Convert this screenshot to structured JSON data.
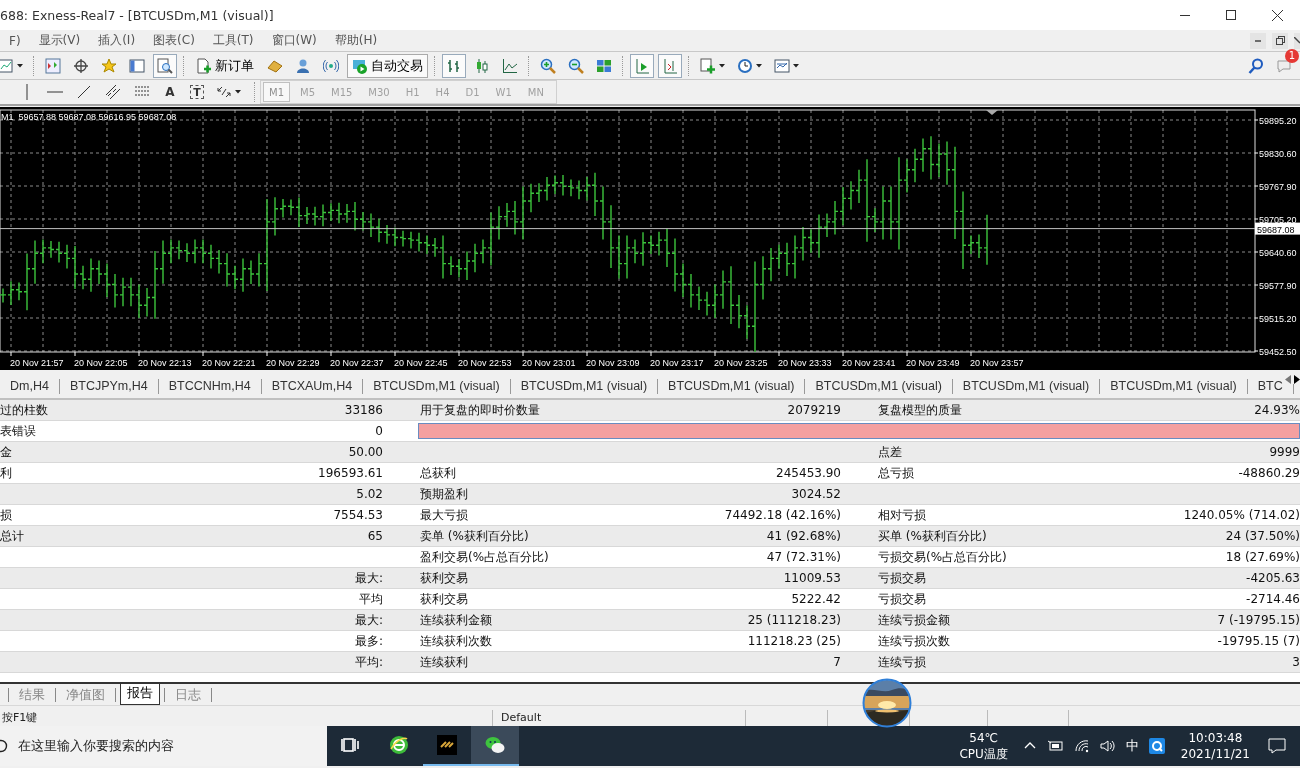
{
  "window": {
    "title": "688: Exness-Real7 - [BTCUSDm,M1 (visual)]"
  },
  "menu": [
    "F)",
    "显示(V)",
    "插入(I)",
    "图表(C)",
    "工具(T)",
    "窗口(W)",
    "帮助(H)"
  ],
  "toolbar": [
    {
      "kind": "icon",
      "pressed": false
    },
    {
      "kind": "icon",
      "pressed": false
    },
    {
      "kind": "icon",
      "pressed": false
    },
    {
      "kind": "icon",
      "pressed": false
    },
    {
      "kind": "icon",
      "pressed": false
    },
    {
      "kind": "icon",
      "pressed": true
    },
    {
      "kind": "button",
      "label": "新订单"
    },
    {
      "kind": "icon",
      "pressed": false
    },
    {
      "kind": "icon",
      "pressed": false
    },
    {
      "kind": "icon",
      "pressed": false
    },
    {
      "kind": "button",
      "label": "自动交易"
    },
    {
      "kind": "icon",
      "pressed": true
    },
    {
      "kind": "icon",
      "pressed": false
    },
    {
      "kind": "icon",
      "pressed": false
    },
    {
      "kind": "icon",
      "pressed": false
    },
    {
      "kind": "icon",
      "pressed": false
    },
    {
      "kind": "icon",
      "pressed": false
    },
    {
      "kind": "icon",
      "pressed": true
    },
    {
      "kind": "icon",
      "pressed": true
    },
    {
      "kind": "icon",
      "pressed": false
    },
    {
      "kind": "icon",
      "pressed": false
    },
    {
      "kind": "icon",
      "pressed": false
    }
  ],
  "notifications": {
    "badge": "1"
  },
  "drawing_toolbar": [
    {
      "kind": "icon"
    },
    {
      "kind": "icon"
    },
    {
      "kind": "icon"
    },
    {
      "kind": "icon"
    },
    {
      "kind": "icon"
    },
    {
      "kind": "text",
      "label": "A"
    },
    {
      "kind": "boxed",
      "label": "T"
    },
    {
      "kind": "icon"
    }
  ],
  "timeframes": [
    {
      "label": "M1",
      "selected": true
    },
    {
      "label": "M5",
      "selected": false
    },
    {
      "label": "M15",
      "selected": false
    },
    {
      "label": "M30",
      "selected": false
    },
    {
      "label": "H1",
      "selected": false
    },
    {
      "label": "H4",
      "selected": false
    },
    {
      "label": "D1",
      "selected": false
    },
    {
      "label": "W1",
      "selected": false
    },
    {
      "label": "MN",
      "selected": false
    }
  ],
  "chart": {
    "info": "M1  59657.88 59687.08 59616.95 59687.08",
    "price_labels": [
      "59895.20",
      "59830.60",
      "59767.90",
      "59705.20",
      "59640.60",
      "59577.90",
      "59515.20",
      "59452.50"
    ],
    "current_price": "59687.08",
    "time_labels": [
      "20 Nov 21:57",
      "20 Nov 22:05",
      "20 Nov 22:13",
      "20 Nov 22:21",
      "20 Nov 22:29",
      "20 Nov 22:37",
      "20 Nov 22:45",
      "20 Nov 22:53",
      "20 Nov 23:01",
      "20 Nov 23:09",
      "20 Nov 23:17",
      "20 Nov 23:25",
      "20 Nov 23:33",
      "20 Nov 23:41",
      "20 Nov 23:49",
      "20 Nov 23:57"
    ]
  },
  "chart_tabs": [
    "Dm,H4",
    "BTCJPYm,H4",
    "BTCCNHm,H4",
    "BTCXAUm,H4",
    "BTCUSDm,M1 (visual)",
    "BTCUSDm,M1 (visual)",
    "BTCUSDm,M1 (visual)",
    "BTCUSDm,M1 (visual)",
    "BTCUSDm,M1 (visual)",
    "BTCUSDm,M1 (visual)",
    "BTC"
  ],
  "report": {
    "rows": [
      {
        "kind": "values",
        "label_1": "过的柱数",
        "value_1": "33186",
        "label_2": "用于复盘的即时价数量",
        "value_2": "2079219",
        "label_3": "复盘模型的质量",
        "value_3": "24.93%"
      },
      {
        "kind": "error",
        "label_1": "表错误",
        "value_1": "0"
      },
      {
        "kind": "values",
        "label_1": "金",
        "value_1": "50.00",
        "label_3": "点差",
        "value_3": "9999"
      },
      {
        "kind": "values",
        "label_1": "利",
        "value_1": "196593.61",
        "label_2": "总获利",
        "value_2": "245453.90",
        "label_3": "总亏损",
        "value_3": "-48860.29"
      },
      {
        "kind": "values",
        "value_1": "5.02",
        "label_2": "预期盈利",
        "value_2": "3024.52"
      },
      {
        "kind": "values",
        "label_1": "损",
        "value_1": "7554.53",
        "label_2": "最大亏损",
        "value_2": "74492.18 (42.16%)",
        "label_3": "相对亏损",
        "value_3": "1240.05% (714.02)"
      },
      {
        "kind": "values",
        "label_1": "总计",
        "value_1": "65",
        "label_2": "卖单 (%获利百分比)",
        "value_2": "41 (92.68%)",
        "label_3": "买单 (%获利百分比)",
        "value_3": "24 (37.50%)"
      },
      {
        "kind": "values",
        "label_2": "盈利交易(%占总百分比)",
        "value_2": "47 (72.31%)",
        "label_3": "亏损交易(%占总百分比)",
        "value_3": "18 (27.69%)"
      },
      {
        "kind": "values",
        "value_1": "最大:",
        "label_2": "获利交易",
        "value_2": "11009.53",
        "label_3": "亏损交易",
        "value_3": "-4205.63"
      },
      {
        "kind": "values",
        "value_1": "平均",
        "label_2": "获利交易",
        "value_2": "5222.42",
        "label_3": "亏损交易",
        "value_3": "-2714.46"
      },
      {
        "kind": "values",
        "value_1": "最大:",
        "label_2": "连续获利金额",
        "value_2": "25 (111218.23)",
        "label_3": "连续亏损金额",
        "value_3": "7 (-19795.15)"
      },
      {
        "kind": "values",
        "value_1": "最多:",
        "label_2": "连续获利次数",
        "value_2": "111218.23 (25)",
        "label_3": "连续亏损次数",
        "value_3": "-19795.15 (7)"
      },
      {
        "kind": "values",
        "value_1": "平均:",
        "label_2": "连续获利",
        "value_2": "7",
        "label_3": "连续亏损",
        "value_3": "3"
      }
    ]
  },
  "bottom_tabs": [
    {
      "label": "结果",
      "selected": false
    },
    {
      "label": "净值图",
      "selected": false
    },
    {
      "label": "报告",
      "selected": true
    },
    {
      "label": "日志",
      "selected": false
    }
  ],
  "status_bar": {
    "help": "按F1键",
    "profile": "Default"
  },
  "taskbar": {
    "search_placeholder": "在这里输入你要搜索的内容",
    "apps": [
      {
        "active": false
      },
      {
        "active": false
      },
      {
        "active": false
      },
      {
        "active": true
      }
    ],
    "temperature": "54℃",
    "temperature_label": "CPU温度",
    "ime": "中",
    "time": "10:03:48",
    "date": "2021/11/21"
  }
}
